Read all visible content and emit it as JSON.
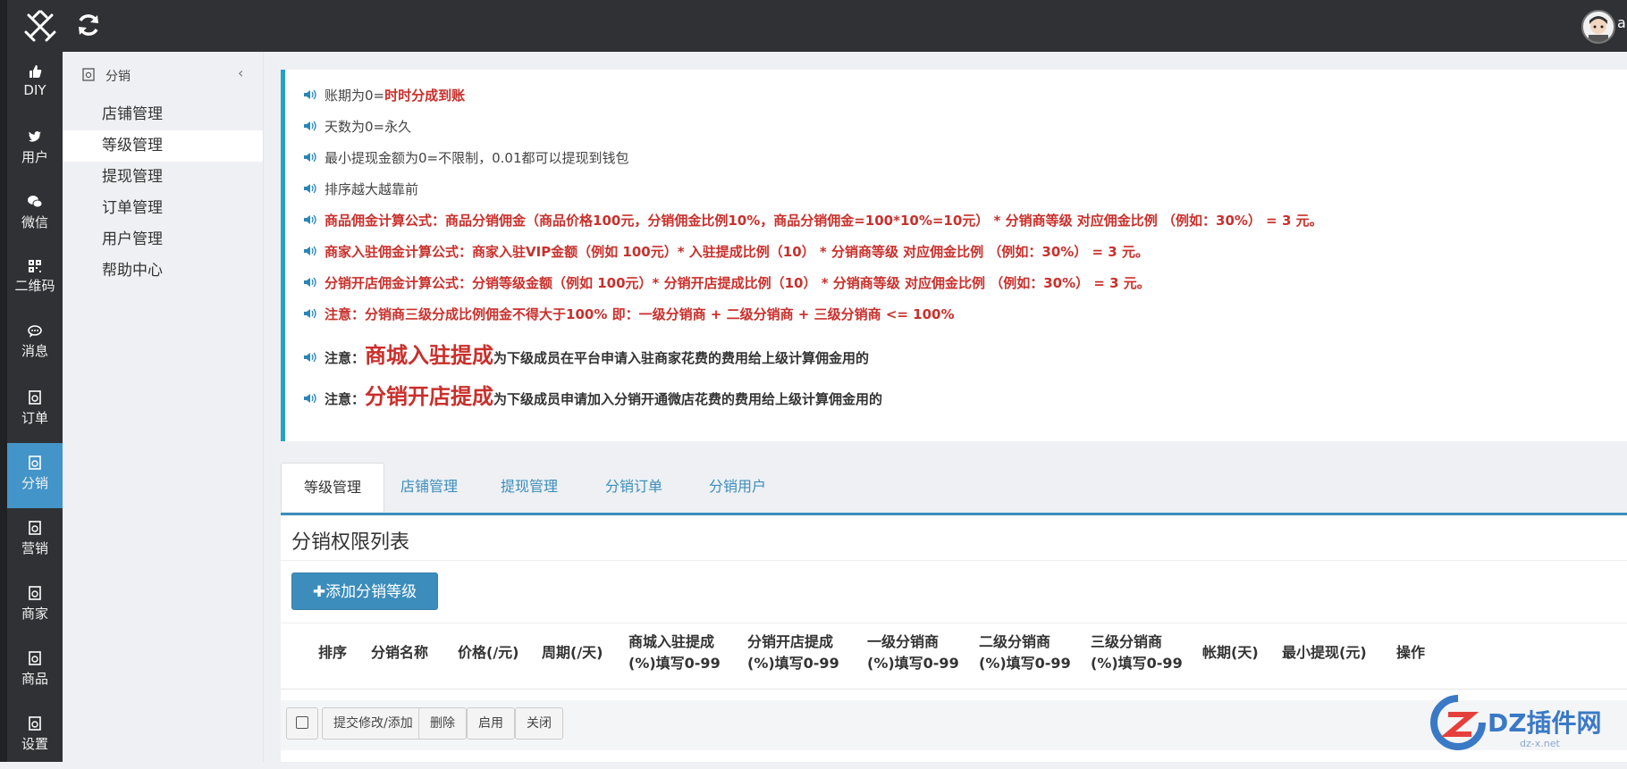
{
  "topbar": {
    "user_initial": "a"
  },
  "leftnav": [
    {
      "label": "DIY",
      "icon": "thumbs-up-icon"
    },
    {
      "label": "用户",
      "icon": "twitter-bird-icon"
    },
    {
      "label": "微信",
      "icon": "wechat-icon"
    },
    {
      "label": "二维码",
      "icon": "qrcode-icon"
    },
    {
      "label": "消息",
      "icon": "chat-bubble-icon"
    },
    {
      "label": "订单",
      "icon": "document-icon"
    },
    {
      "label": "分销",
      "icon": "document-icon",
      "active": true
    },
    {
      "label": "营销",
      "icon": "document-icon"
    },
    {
      "label": "商家",
      "icon": "document-icon"
    },
    {
      "label": "商品",
      "icon": "document-icon"
    },
    {
      "label": "设置",
      "icon": "document-icon"
    }
  ],
  "subsidebar": {
    "title": "分销",
    "items": [
      "店铺管理",
      "等级管理",
      "提现管理",
      "订单管理",
      "用户管理",
      "帮助中心"
    ],
    "active_index": 1
  },
  "notice": {
    "l1_a": "账期为0=",
    "l1_b": "时时分成到账",
    "l2": "天数为0=永久",
    "l3": "最小提现金额为0=不限制，0.01都可以提现到钱包",
    "l4": "排序越大越靠前",
    "l5": "商品佣金计算公式：商品分销佣金（商品价格100元，分销佣金比例10%，商品分销佣金=100*10%=10元） * 分销商等级 对应佣金比例 （例如：30%） = 3 元。",
    "l6": "商家入驻佣金计算公式：商家入驻VIP金额（例如 100元）* 入驻提成比例（10） * 分销商等级 对应佣金比例 （例如：30%） = 3 元。",
    "l7": "分销开店佣金计算公式：分销等级金额（例如 100元）* 分销开店提成比例（10） * 分销商等级 对应佣金比例 （例如：30%） = 3 元。",
    "l8": "注意：分销商三级分成比例佣金不得大于100% 即：一级分销商 + 二级分销商 + 三级分销商 <= 100%",
    "l9_a": "注意：",
    "l9_b": "商城入驻提成",
    "l9_c": "为下级成员在平台申请入驻商家花费的费用给上级计算佣金用的",
    "l10_a": "注意：",
    "l10_b": "分销开店提成",
    "l10_c": "为下级成员申请加入分销开通微店花费的费用给上级计算佣金用的"
  },
  "tabs": [
    "等级管理",
    "店铺管理",
    "提现管理",
    "分销订单",
    "分销用户"
  ],
  "panel": {
    "title": "分销权限列表",
    "add_button": "添加分销等级",
    "columns": [
      {
        "l1": "排序",
        "l2": ""
      },
      {
        "l1": "分销名称",
        "l2": ""
      },
      {
        "l1": "价格(/元)",
        "l2": ""
      },
      {
        "l1": "周期(/天)",
        "l2": ""
      },
      {
        "l1": "商城入驻提成",
        "l2": "(%)填写0-99"
      },
      {
        "l1": "分销开店提成",
        "l2": "(%)填写0-99"
      },
      {
        "l1": "一级分销商",
        "l2": "(%)填写0-99"
      },
      {
        "l1": "二级分销商",
        "l2": "(%)填写0-99"
      },
      {
        "l1": "三级分销商",
        "l2": "(%)填写0-99"
      },
      {
        "l1": "帐期(天)",
        "l2": ""
      },
      {
        "l1": "最小提现(元)",
        "l2": ""
      },
      {
        "l1": "操作",
        "l2": ""
      }
    ]
  },
  "footer": {
    "submit": "提交修改/添加",
    "delete": "删除",
    "enable": "启用",
    "close": "关闭"
  },
  "watermark": {
    "brand": "DZ插件网",
    "sub": "dz-x.net"
  },
  "colors": {
    "accent": "#3c8dbc",
    "danger": "#c9302c",
    "dark": "#2f3134"
  }
}
